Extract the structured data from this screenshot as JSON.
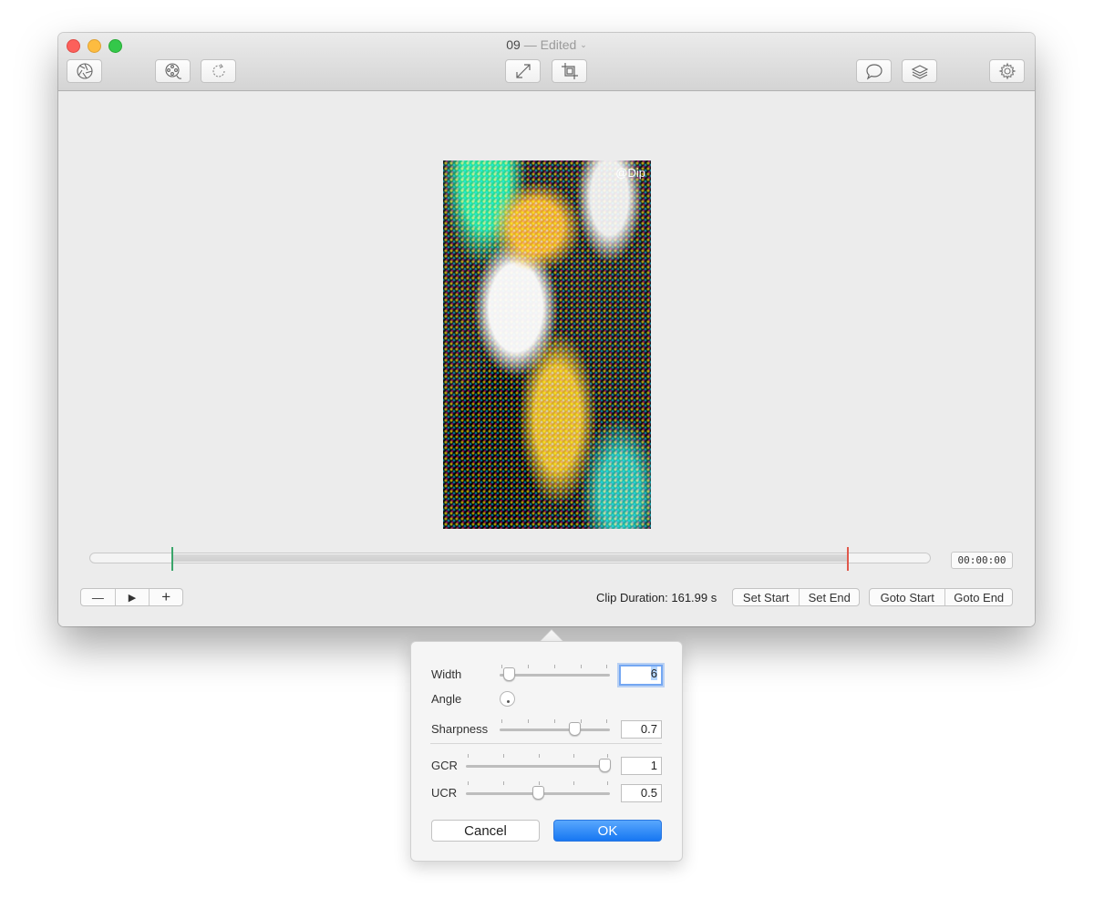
{
  "window": {
    "title_name": "09",
    "title_sep": "—",
    "title_status": "Edited",
    "title_chevron": "⌄"
  },
  "toolbar": {
    "buttons": [
      {
        "name": "aperture-icon"
      },
      {
        "name": "film-reel-icon"
      },
      {
        "name": "refresh-icon"
      },
      {
        "name": "resize-icon"
      },
      {
        "name": "crop-icon"
      },
      {
        "name": "speech-bubble-icon"
      },
      {
        "name": "layers-icon"
      },
      {
        "name": "gear-icon"
      }
    ]
  },
  "preview": {
    "watermark": "@Dip"
  },
  "timeline": {
    "timecode": "00:00:00",
    "start_marker_color": "#3aa56a",
    "end_marker_color": "#e0584b"
  },
  "controls": {
    "zoom_out": "—",
    "play": "▶",
    "zoom_in": "+",
    "clip_duration": "Clip Duration: 161.99 s",
    "set_start": "Set Start",
    "set_end": "Set End",
    "goto_start": "Goto Start",
    "goto_end": "Goto End"
  },
  "popover": {
    "width_label": "Width",
    "width_value": "6",
    "angle_label": "Angle",
    "sharpness_label": "Sharpness",
    "sharpness_value": "0.7",
    "gcr_label": "GCR",
    "gcr_value": "1",
    "ucr_label": "UCR",
    "ucr_value": "0.5",
    "cancel_label": "Cancel",
    "ok_label": "OK",
    "ok_color": "#1777f2"
  }
}
